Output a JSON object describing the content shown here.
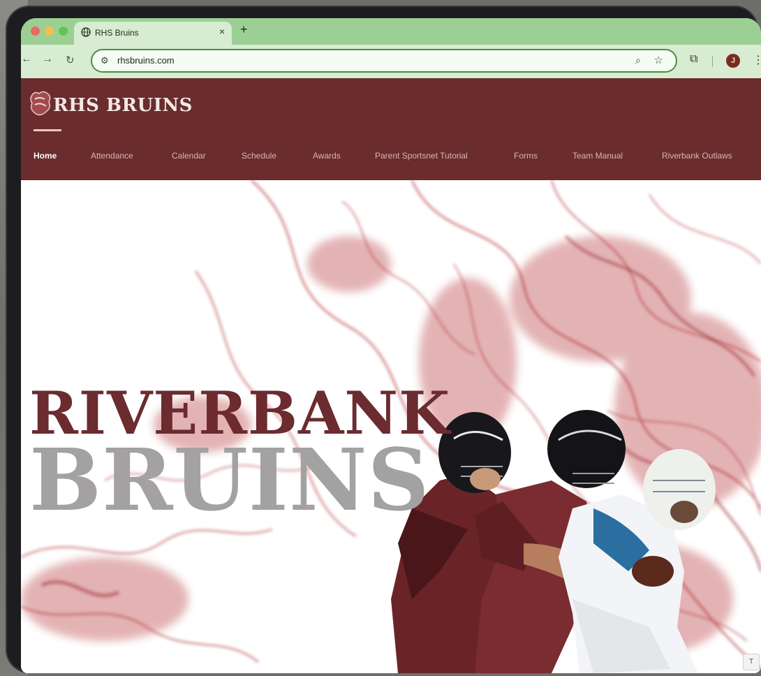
{
  "browser": {
    "tab_title": "RHS Bruins",
    "tab_close": "×",
    "new_tab": "+",
    "url": "rhsbruins.com",
    "profile_initial": "J",
    "icons": [
      "globe-icon",
      "back-icon",
      "forward-icon",
      "reload-icon",
      "site-info-icon",
      "zoom-icon",
      "star-icon",
      "extensions-icon",
      "menu-icon"
    ]
  },
  "site": {
    "logo_text": "RHS BRUINS",
    "nav": [
      {
        "label": "Home",
        "active": true
      },
      {
        "label": "Attendance"
      },
      {
        "label": "Calendar"
      },
      {
        "label": "Schedule"
      },
      {
        "label": "Awards"
      },
      {
        "label": "Parent Sportsnet Tutorial"
      },
      {
        "label": "Forms"
      },
      {
        "label": "Team Manual"
      },
      {
        "label": "Riverbank Outlaws"
      }
    ],
    "colors": {
      "header": "#6a2c2d",
      "accent": "#6b2b2f",
      "smoke": "#b0252a",
      "gray": "#a3a1a2"
    }
  },
  "hero": {
    "line1": "RIVERBANK",
    "line2": "BRUINS"
  },
  "corner": "T"
}
